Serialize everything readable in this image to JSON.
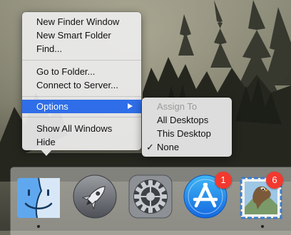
{
  "menu": {
    "items": [
      {
        "label": "New Finder Window"
      },
      {
        "label": "New Smart Folder"
      },
      {
        "label": "Find..."
      },
      {
        "label": "Go to Folder..."
      },
      {
        "label": "Connect to Server..."
      },
      {
        "label": "Options"
      },
      {
        "label": "Show All Windows"
      },
      {
        "label": "Hide"
      }
    ]
  },
  "submenu": {
    "header": "Assign To",
    "options": [
      {
        "label": "All Desktops"
      },
      {
        "label": "This Desktop"
      },
      {
        "label": "None"
      }
    ],
    "selected_mark": "✓"
  },
  "dock": {
    "items": [
      {
        "icon": "finder-icon"
      },
      {
        "icon": "launchpad-icon"
      },
      {
        "icon": "system-preferences-icon"
      },
      {
        "icon": "app-store-icon",
        "badge": "1"
      },
      {
        "icon": "mail-icon",
        "badge": "6"
      }
    ]
  },
  "colors": {
    "highlight": "#2f6ee8",
    "badge": "#f2392f"
  }
}
